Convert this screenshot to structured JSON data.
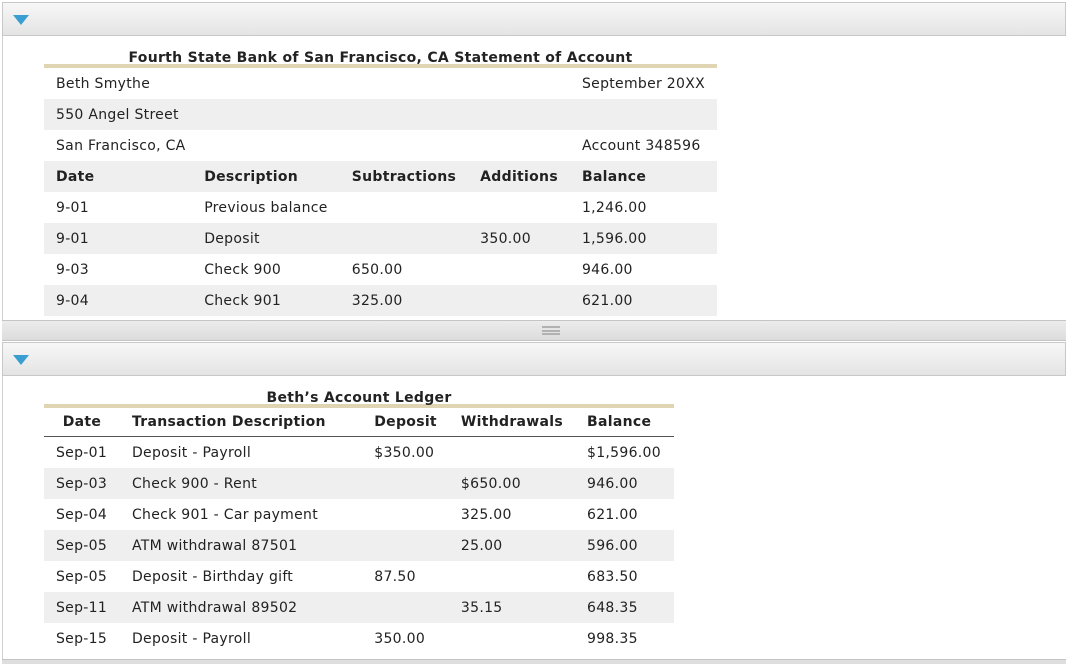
{
  "statement": {
    "title": "Fourth State Bank of San Francisco, CA Statement of Account",
    "name": "Beth Smythe",
    "period": "September 20XX",
    "street": "550 Angel Street",
    "city": "San Francisco, CA",
    "account": "Account 348596",
    "headers": [
      "Date",
      "Description",
      "Subtractions",
      "Additions",
      "Balance"
    ],
    "rows": [
      [
        "9-01",
        "Previous balance",
        "",
        "",
        "1,246.00"
      ],
      [
        "9-01",
        "Deposit",
        "",
        "350.00",
        "1,596.00"
      ],
      [
        "9-03",
        "Check 900",
        "650.00",
        "",
        "946.00"
      ],
      [
        "9-04",
        "Check 901",
        "325.00",
        "",
        "621.00"
      ]
    ]
  },
  "ledger": {
    "title": "Beth’s Account Ledger",
    "headers": [
      "Date",
      "Transaction Description",
      "Deposit",
      "Withdrawals",
      "Balance"
    ],
    "rows": [
      [
        "Sep-01",
        "Deposit - Payroll",
        "$350.00",
        "",
        "$1,596.00"
      ],
      [
        "Sep-03",
        "Check 900 - Rent",
        "",
        "$650.00",
        "946.00"
      ],
      [
        "Sep-04",
        "Check 901 - Car payment",
        "",
        "325.00",
        "621.00"
      ],
      [
        "Sep-05",
        "ATM withdrawal 87501",
        "",
        "25.00",
        "596.00"
      ],
      [
        "Sep-05",
        "Deposit - Birthday gift",
        "87.50",
        "",
        "683.50"
      ],
      [
        "Sep-11",
        "ATM withdrawal 89502",
        "",
        "35.15",
        "648.35"
      ],
      [
        "Sep-15",
        "Deposit - Payroll",
        "350.00",
        "",
        "998.35"
      ]
    ]
  },
  "colors": {
    "accent_border": "#e0d5b3",
    "collapse_icon": "#3a9fd0",
    "row_stripe": "#efefef"
  }
}
